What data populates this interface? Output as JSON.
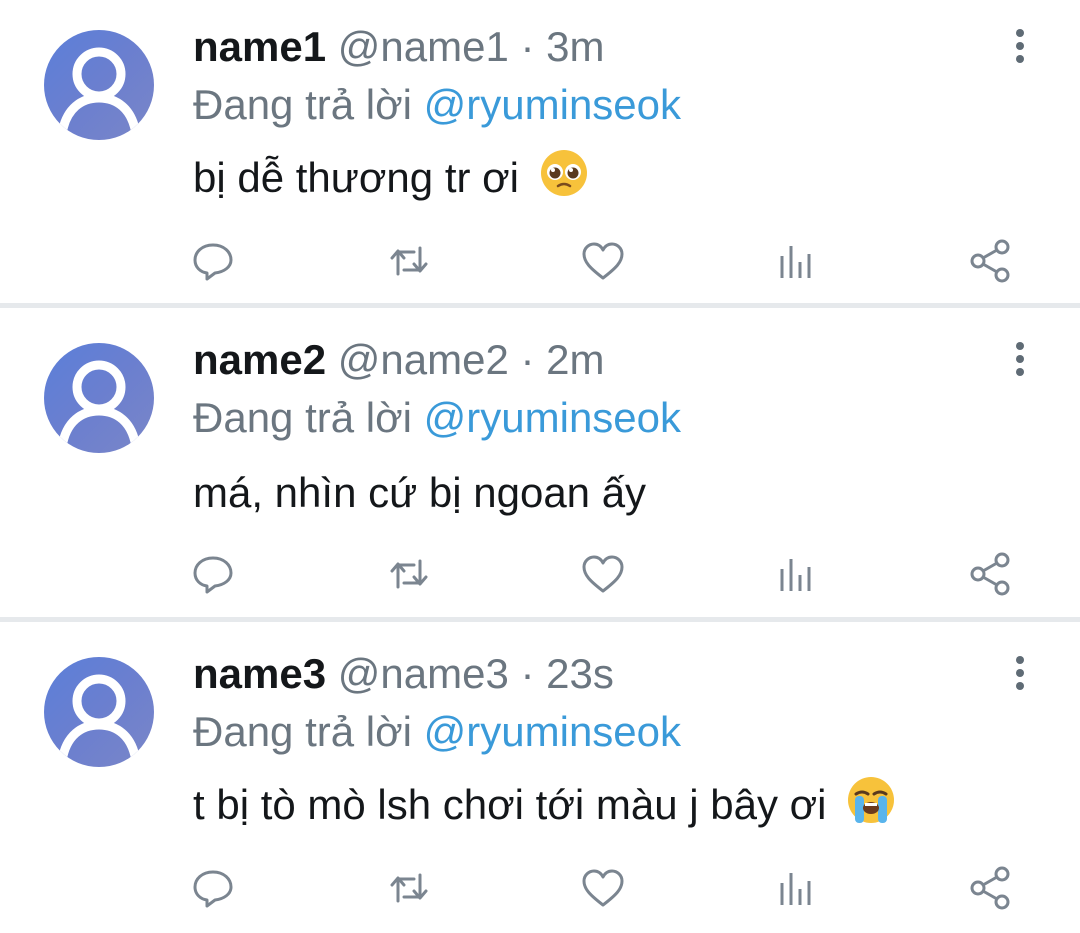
{
  "tweets": [
    {
      "name": "name1",
      "handle": "@name1",
      "separator": "·",
      "time": "3m",
      "reply_prefix": "Đang trả lời",
      "reply_mention": "@ryuminseok",
      "text": "bị dễ thương tr ơi",
      "emoji": "pleading-face-emoji"
    },
    {
      "name": "name2",
      "handle": "@name2",
      "separator": "·",
      "time": "2m",
      "reply_prefix": "Đang trả lời",
      "reply_mention": "@ryuminseok",
      "text": "má, nhìn cứ bị ngoan ấy",
      "emoji": ""
    },
    {
      "name": "name3",
      "handle": "@name3",
      "separator": "·",
      "time": "23s",
      "reply_prefix": "Đang trả lời",
      "reply_mention": "@ryuminseok",
      "text": "t bị tò mò lsh chơi tới màu j bây ơi",
      "emoji": "loudly-crying-face-emoji"
    }
  ],
  "icons": {
    "reply": "reply-icon",
    "retweet": "retweet-icon",
    "like": "heart-icon",
    "analytics": "analytics-icon",
    "share": "share-icon",
    "more": "more-vertical-icon"
  },
  "colors": {
    "mention": "#3a9ad9",
    "secondary_text": "#6b7680",
    "avatar": "#6b7fcf",
    "divider": "#e6e9ec"
  }
}
